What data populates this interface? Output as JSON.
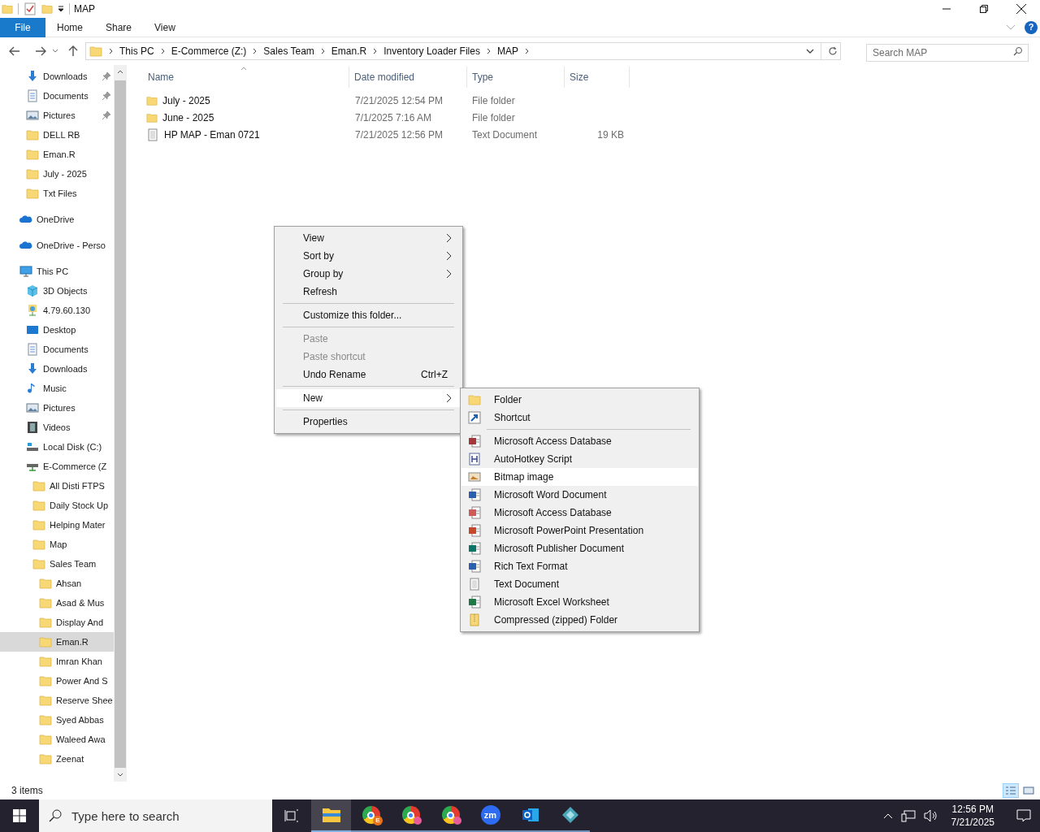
{
  "window": {
    "title": "MAP"
  },
  "ribbon_tabs": [
    {
      "label": "File",
      "kind": "file"
    },
    {
      "label": "Home",
      "kind": "tab"
    },
    {
      "label": "Share",
      "kind": "tab"
    },
    {
      "label": "View",
      "kind": "tab"
    }
  ],
  "help_button": "?",
  "address_bar": {
    "crumbs": [
      "This PC",
      "E-Commerce (Z:)",
      "Sales Team",
      "Eman.R",
      "Inventory Loader Files",
      "MAP"
    ]
  },
  "search": {
    "placeholder": "Search MAP"
  },
  "quick_access": [
    {
      "label": "Downloads",
      "kind": "download",
      "pinned": true,
      "selected": false
    },
    {
      "label": "Documents",
      "kind": "document",
      "pinned": true,
      "selected": false
    },
    {
      "label": "Pictures",
      "kind": "picture",
      "pinned": true,
      "selected": false
    },
    {
      "label": "DELL RB",
      "kind": "folder",
      "pinned": false,
      "selected": false
    },
    {
      "label": "Eman.R",
      "kind": "folder",
      "pinned": false,
      "selected": false
    },
    {
      "label": "July - 2025",
      "kind": "folder",
      "pinned": false,
      "selected": false
    },
    {
      "label": "Txt Files",
      "kind": "folder",
      "pinned": false,
      "selected": false
    }
  ],
  "tree": [
    {
      "label": "OneDrive",
      "kind": "cloud",
      "selected": false
    },
    {
      "label": "OneDrive - Perso",
      "kind": "cloud",
      "selected": false
    },
    {
      "label": "This PC",
      "kind": "pc",
      "selected": false,
      "children": [
        {
          "label": "3D Objects",
          "kind": "cube",
          "selected": false
        },
        {
          "label": "4.79.60.130",
          "kind": "network",
          "selected": false
        },
        {
          "label": "Desktop",
          "kind": "desktop",
          "selected": false
        },
        {
          "label": "Documents",
          "kind": "document",
          "selected": false
        },
        {
          "label": "Downloads",
          "kind": "download",
          "selected": false
        },
        {
          "label": "Music",
          "kind": "music",
          "selected": false
        },
        {
          "label": "Pictures",
          "kind": "picture",
          "selected": false
        },
        {
          "label": "Videos",
          "kind": "video",
          "selected": false
        },
        {
          "label": "Local Disk (C:)",
          "kind": "disk",
          "selected": false
        },
        {
          "label": "E-Commerce (Z",
          "kind": "netdrive",
          "selected": false,
          "children": [
            {
              "label": "All Disti FTPS",
              "kind": "folder",
              "selected": false
            },
            {
              "label": "Daily Stock Up",
              "kind": "folder",
              "selected": false
            },
            {
              "label": "Helping Mater",
              "kind": "folder",
              "selected": false
            },
            {
              "label": "Map",
              "kind": "folder",
              "selected": false
            },
            {
              "label": "Sales Team",
              "kind": "folder",
              "selected": false,
              "children": [
                {
                  "label": "Ahsan",
                  "kind": "folder",
                  "selected": false
                },
                {
                  "label": "Asad & Mus",
                  "kind": "folder",
                  "selected": false
                },
                {
                  "label": "Display And",
                  "kind": "folder",
                  "selected": false
                },
                {
                  "label": "Eman.R",
                  "kind": "folder",
                  "selected": true
                },
                {
                  "label": "Imran Khan",
                  "kind": "folder",
                  "selected": false
                },
                {
                  "label": "Power And S",
                  "kind": "folder",
                  "selected": false
                },
                {
                  "label": "Reserve Shee",
                  "kind": "folder",
                  "selected": false
                },
                {
                  "label": "Syed Abbas",
                  "kind": "folder",
                  "selected": false
                },
                {
                  "label": "Waleed Awa",
                  "kind": "folder",
                  "selected": false
                },
                {
                  "label": "Zeenat",
                  "kind": "folder",
                  "selected": false
                }
              ]
            }
          ]
        }
      ]
    }
  ],
  "table": {
    "columns": [
      "Name",
      "Date modified",
      "Type",
      "Size"
    ],
    "rows": [
      {
        "kind": "folder",
        "name": "July - 2025",
        "date": "7/21/2025 12:54 PM",
        "type": "File folder"
      },
      {
        "kind": "folder",
        "name": "June - 2025",
        "date": "7/1/2025 7:16 AM",
        "type": "File folder"
      },
      {
        "kind": "text",
        "name": "HP MAP - Eman 0721",
        "date": "7/21/2025 12:56 PM",
        "type": "Text Document",
        "size": "19 KB"
      }
    ]
  },
  "context_menu": [
    {
      "kind": "item",
      "label": "View",
      "submenu": true,
      "disabled": false,
      "selected": false
    },
    {
      "kind": "item",
      "label": "Sort by",
      "submenu": true,
      "disabled": false,
      "selected": false
    },
    {
      "kind": "item",
      "label": "Group by",
      "submenu": true,
      "disabled": false,
      "selected": false
    },
    {
      "kind": "item",
      "label": "Refresh",
      "submenu": false,
      "disabled": false,
      "selected": false
    },
    {
      "kind": "separator"
    },
    {
      "kind": "item",
      "label": "Customize this folder...",
      "submenu": false,
      "disabled": false,
      "selected": false
    },
    {
      "kind": "separator"
    },
    {
      "kind": "item",
      "label": "Paste",
      "submenu": false,
      "disabled": true,
      "selected": false
    },
    {
      "kind": "item",
      "label": "Paste shortcut",
      "submenu": false,
      "disabled": true,
      "selected": false
    },
    {
      "kind": "item",
      "label": "Undo Rename",
      "shortcut": "Ctrl+Z",
      "submenu": false,
      "disabled": false,
      "selected": false
    },
    {
      "kind": "separator"
    },
    {
      "kind": "item",
      "label": "New",
      "submenu": true,
      "disabled": false,
      "selected": true
    },
    {
      "kind": "separator"
    },
    {
      "kind": "item",
      "label": "Properties",
      "submenu": false,
      "disabled": false,
      "selected": false
    }
  ],
  "new_submenu": [
    {
      "kind": "folder",
      "label": "Folder",
      "selected": false
    },
    {
      "kind": "shortcut",
      "label": "Shortcut",
      "selected": false
    },
    {
      "kind": "separator"
    },
    {
      "kind": "access",
      "label": "Microsoft Access Database",
      "selected": false
    },
    {
      "kind": "ahk",
      "label": "AutoHotkey Script",
      "selected": false
    },
    {
      "kind": "bitmap",
      "label": "Bitmap image",
      "selected": true
    },
    {
      "kind": "word",
      "label": "Microsoft Word Document",
      "selected": false
    },
    {
      "kind": "access2",
      "label": "Microsoft Access Database",
      "selected": false
    },
    {
      "kind": "powerpoint",
      "label": "Microsoft PowerPoint Presentation",
      "selected": false
    },
    {
      "kind": "publisher",
      "label": "Microsoft Publisher Document",
      "selected": false
    },
    {
      "kind": "word",
      "label": "Rich Text Format",
      "selected": false
    },
    {
      "kind": "text",
      "label": "Text Document",
      "selected": false
    },
    {
      "kind": "excel",
      "label": "Microsoft Excel Worksheet",
      "selected": false
    },
    {
      "kind": "zip",
      "label": "Compressed (zipped) Folder",
      "selected": false
    }
  ],
  "status_bar": {
    "items": "3 items",
    "view_buttons": [
      {
        "kind": "details",
        "selected": true
      },
      {
        "kind": "icons",
        "selected": false
      }
    ]
  },
  "taskbar": {
    "search_placeholder": "Type here to search",
    "apps": [
      {
        "kind": "explorer",
        "active": true
      },
      {
        "kind": "chrome",
        "badge": "E",
        "active": false
      },
      {
        "kind": "chrome-profile",
        "active": false
      },
      {
        "kind": "chrome-profile",
        "active": false
      },
      {
        "kind": "zoom",
        "text": "zm",
        "active": false
      },
      {
        "kind": "outlook",
        "active": false
      },
      {
        "kind": "diamond",
        "active": false
      }
    ],
    "time": "12:56 PM",
    "date": "7/21/2025"
  }
}
